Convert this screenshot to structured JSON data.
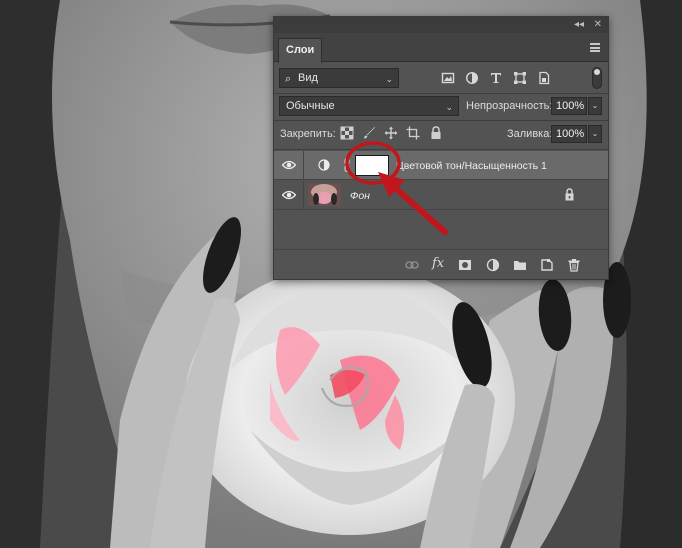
{
  "panel": {
    "tab_label": "Слои",
    "title_controls": {
      "collapse": "◂◂",
      "close": "✕"
    }
  },
  "filter": {
    "kind_label": "Вид",
    "icons": [
      "image-filter-icon",
      "adjustment-filter-icon",
      "type-filter-icon",
      "shape-filter-icon",
      "smart-object-filter-icon"
    ]
  },
  "blend": {
    "mode": "Обычные",
    "opacity_label": "Непрозрачность:",
    "opacity_value": "100%"
  },
  "lock": {
    "label": "Закрепить:",
    "fill_label": "Заливка:",
    "fill_value": "100%"
  },
  "layers": [
    {
      "name": "Цветовой тон/Насыщенность 1",
      "type": "adjustment",
      "selected": true,
      "visible": true
    },
    {
      "name": "Фон",
      "type": "background",
      "selected": false,
      "visible": true,
      "locked": true
    }
  ],
  "footer": {
    "fx_label": "fx",
    "icons": [
      "link-layers-icon",
      "fx-icon",
      "add-mask-icon",
      "new-adjustment-icon",
      "new-group-icon",
      "new-layer-icon",
      "delete-layer-icon"
    ]
  },
  "colors": {
    "panel_bg": "#535353",
    "selected_row": "#6a6a6a",
    "annotation_red": "#c0161c"
  }
}
